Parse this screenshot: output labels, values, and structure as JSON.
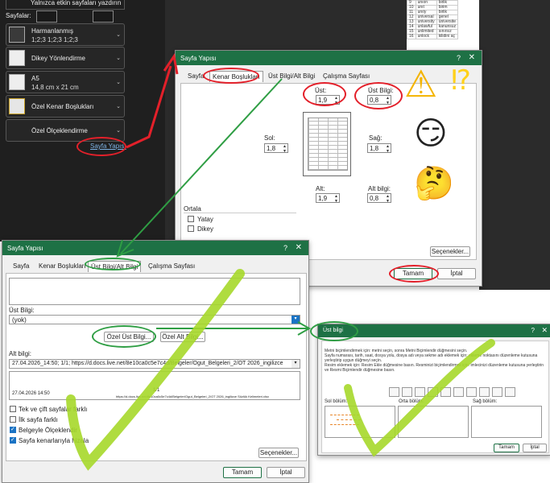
{
  "backstage": {
    "top_text": "Yalnızca etkin sayfaları yazdırın",
    "pages_label": "Sayfalar:",
    "collate": {
      "title": "Harmanlanmış",
      "sub": "1;2;3   1;2;3   1;2;3"
    },
    "orientation": {
      "title": "Dikey Yönlendirme"
    },
    "paper": {
      "title": "A5",
      "sub": "14,8 cm x 21 cm"
    },
    "margins": {
      "title": "Özel Kenar Boşlukları"
    },
    "scaling": {
      "title": "Özel Ölçeklendirme"
    },
    "page_setup_link": "Sayfa Yapısı"
  },
  "preview_rows": [
    [
      "9",
      "unıon",
      "birlik"
    ],
    [
      "10",
      "unıt",
      "birim"
    ],
    [
      "11",
      "unıty",
      "birlik"
    ],
    [
      "12",
      "universal",
      "genel"
    ],
    [
      "13",
      "university",
      "üniversite"
    ],
    [
      "14",
      "unlawful",
      "kanunsuz"
    ],
    [
      "15",
      "unlimited",
      "sınırsız"
    ],
    [
      "16",
      "unlock",
      "kilidini aç"
    ]
  ],
  "dialog_margins": {
    "title": "Sayfa Yapısı",
    "help": "?",
    "close": "✕",
    "tabs": [
      "Sayfa",
      "Kenar Boşlukları",
      "Üst Bilgi/Alt Bilgi",
      "Çalışma Sayfası"
    ],
    "top_label": "Üst:",
    "top_value": "1,9",
    "header_label": "Üst Bilgi:",
    "header_value": "0,8",
    "left_label": "Sol:",
    "left_value": "1,8",
    "right_label": "Sağ:",
    "right_value": "1,8",
    "bottom_label": "Alt:",
    "bottom_value": "1,9",
    "footer_label": "Alt bilgi:",
    "footer_value": "0,8",
    "center_label": "Ortala",
    "horizontal_label": "Yatay",
    "vertical_label": "Dikey",
    "options_button": "Seçenekler...",
    "ok_button": "Tamam",
    "cancel_button": "İptal"
  },
  "dialog_header": {
    "title": "Sayfa Yapısı",
    "help": "?",
    "close": "✕",
    "tabs": [
      "Sayfa",
      "Kenar Boşlukları",
      "Üst Bilgi/Alt Bilgi",
      "Çalışma Sayfası"
    ],
    "header_label": "Üst Bilgi:",
    "header_value": "(yok)",
    "custom_header_button": "Özel Üst Bilgi...",
    "custom_footer_button": "Özel Alt Bilgi...",
    "footer_label": "Alt bilgi:",
    "footer_value": "27.04.2026_14:50; 1/1; https://d.docs.live.net/8e10ca0c5e7c4d/Belgeler/Ogut_Belgeleri_2/OT 2026_ingilizce",
    "footer_preview_left": "27.04.2026  14:50",
    "footer_preview_center": "1/1",
    "footer_preview_right": "https://d.docs.live.net/8e10ca0c5e7c4d/Belgeler/Ogut_Belgeleri_2/OT 2026_ingilizce Sözlük Kelimeleri.xlsx",
    "odd_even_label": "Tek ve çift sayfalar farklı",
    "first_page_label": "İlk sayfa farklı",
    "scale_label": "Belgeyle Ölçeklendir",
    "align_label": "Sayfa kenarlarıyla hizala",
    "options_button": "Seçenekler...",
    "ok_button": "Tamam",
    "cancel_button": "İptal"
  },
  "dialog_footer_editor": {
    "title": "Üst bilgi",
    "help": "?",
    "close": "✕",
    "instructions_1": "Metni biçimlendirmek için: metni seçin, sonra Metni Biçimlendir düğmesini seçin.",
    "instructions_2": "Sayfa numarası, tarih, saat, dosya yolu, dosya adı veya sekme adı eklemek için: ekleme noktasını düzenleme kutusuna yerleştirip uygun düğmeyi seçin.",
    "instructions_3": "Resim eklemek için: Resim Ekle düğmesine basın. Resminizi biçimlendirmek için: imlecinizi düzenleme kutusuna yerleştirin ve Resmi Biçimlendir düğmesine basın.",
    "left_label": "Sol bölüm:",
    "center_label": "Orta bölüm:",
    "right_label": "Sağ bölüm:",
    "ok_button": "Tamam",
    "cancel_button": "İptal",
    "toolbar_icons": [
      "format-text-icon",
      "page-number-icon",
      "page-count-icon",
      "date-icon",
      "time-icon",
      "file-path-icon",
      "file-name-icon",
      "sheet-name-icon",
      "picture-icon",
      "format-picture-icon"
    ]
  },
  "annotations": {
    "exclaim": "⁉",
    "warning_emoji": "⚠",
    "smirk_emoji": "😏",
    "thinking_emoji": "🤔",
    "colors": {
      "red": "#e3202a",
      "green": "#2f9e44",
      "lime": "#a6d82a",
      "excel_green": "#1e7145"
    }
  }
}
